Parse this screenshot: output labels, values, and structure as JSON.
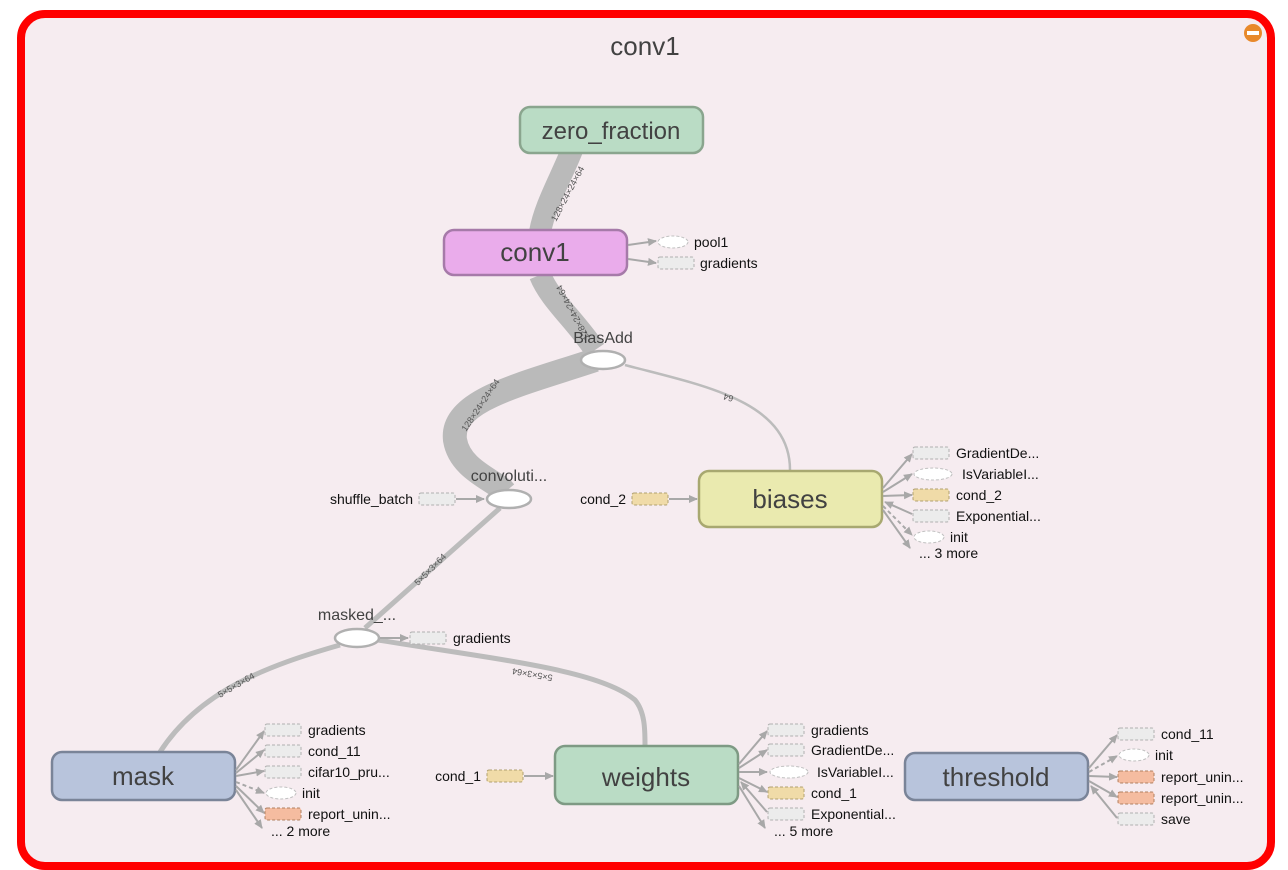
{
  "group_title": "conv1",
  "collapse_icon": "minus-circle-icon",
  "colors": {
    "frame_border": "#ff0000",
    "background": "#f6ecf0",
    "edge": "#b8b8b8",
    "collapse_icon": "#e8892b",
    "zero_fraction_fill": "#badcc5",
    "conv1_fill": "#eaaceb",
    "biases_fill": "#eaeaaf",
    "mask_fill": "#b8c4dc",
    "weights_fill": "#badcc5",
    "threshold_fill": "#b8c4dc",
    "cond_fill": "#f0dba8",
    "report_fill": "#f5bca0",
    "aux_grey_fill": "#ececec"
  },
  "nodes": {
    "zero_fraction": "zero_fraction",
    "conv1": "conv1",
    "biasadd": "BiasAdd",
    "convolution": "convoluti...",
    "biases": "biases",
    "masked": "masked_...",
    "mask": "mask",
    "weights": "weights",
    "threshold": "threshold"
  },
  "edge_labels": {
    "zero_to_conv1": "128×24×24×64",
    "conv1_to_biasadd": "128×24×24×64",
    "biasadd_to_conv": "128×24×24×64",
    "biases_to_biasadd": "64",
    "masked_to_conv": "5×5×3×64",
    "mask_to_masked": "5×5×3×64",
    "weights_to_masked": "5×5×3×64"
  },
  "aux": {
    "conv1": [
      "pool1",
      "gradients"
    ],
    "convolution_in": "shuffle_batch",
    "biases_in": "cond_2",
    "biases_out": [
      "GradientDe...",
      "IsVariableI...",
      "cond_2",
      "Exponential...",
      "init"
    ],
    "biases_more": "... 3 more",
    "masked_out": "gradients",
    "mask_out": [
      "gradients",
      "cond_11",
      "cifar10_pru...",
      "init",
      "report_unin..."
    ],
    "mask_more": "... 2 more",
    "weights_in": "cond_1",
    "weights_out": [
      "gradients",
      "GradientDe...",
      "IsVariableI...",
      "cond_1",
      "Exponential..."
    ],
    "weights_more": "... 5 more",
    "threshold_out": [
      "cond_11",
      "init",
      "report_unin...",
      "report_unin...",
      "save"
    ]
  }
}
